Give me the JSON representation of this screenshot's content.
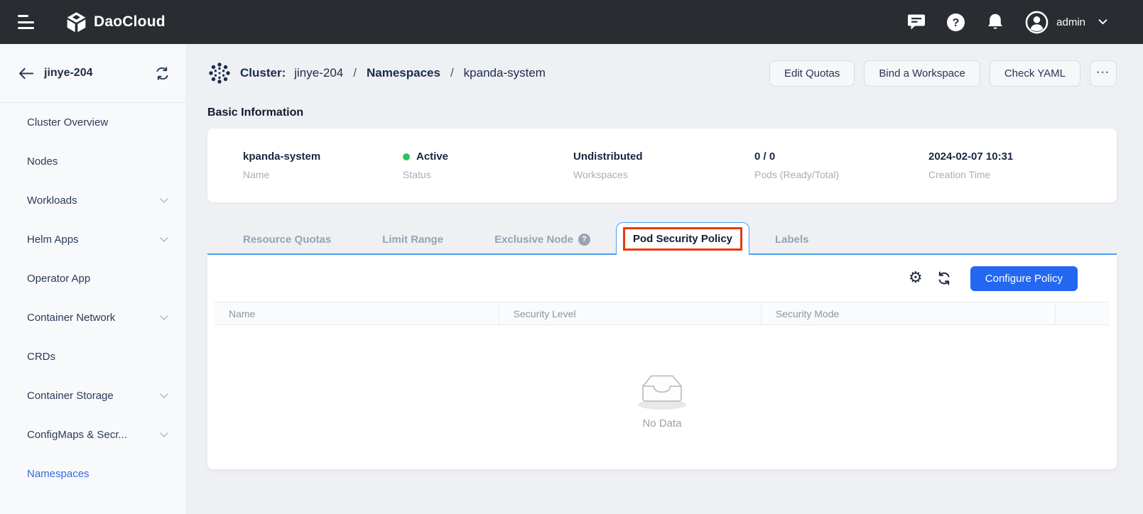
{
  "topbar": {
    "brand": "DaoCloud",
    "user": "admin"
  },
  "sidebar": {
    "cluster_name": "jinye-204",
    "items": [
      {
        "label": "Cluster Overview",
        "expandable": false,
        "active": false
      },
      {
        "label": "Nodes",
        "expandable": false,
        "active": false
      },
      {
        "label": "Workloads",
        "expandable": true,
        "active": false
      },
      {
        "label": "Helm Apps",
        "expandable": true,
        "active": false
      },
      {
        "label": "Operator App",
        "expandable": false,
        "active": false
      },
      {
        "label": "Container Network",
        "expandable": true,
        "active": false
      },
      {
        "label": "CRDs",
        "expandable": false,
        "active": false
      },
      {
        "label": "Container Storage",
        "expandable": true,
        "active": false
      },
      {
        "label": "ConfigMaps & Secr...",
        "expandable": true,
        "active": false
      },
      {
        "label": "Namespaces",
        "expandable": false,
        "active": true
      }
    ]
  },
  "breadcrumb": {
    "label": "Cluster:",
    "cluster": "jinye-204",
    "sep1": "/",
    "section": "Namespaces",
    "sep2": "/",
    "current": "kpanda-system"
  },
  "actions": {
    "edit_quotas": "Edit Quotas",
    "bind_workspace": "Bind a Workspace",
    "check_yaml": "Check YAML",
    "more": "···"
  },
  "basic_info": {
    "title": "Basic Information",
    "fields": [
      {
        "value": "kpanda-system",
        "label": "Name"
      },
      {
        "value": "Active",
        "label": "Status"
      },
      {
        "value": "Undistributed",
        "label": "Workspaces"
      },
      {
        "value": "0 / 0",
        "label": "Pods (Ready/Total)"
      },
      {
        "value": "2024-02-07 10:31",
        "label": "Creation Time"
      }
    ]
  },
  "tabs": [
    {
      "label": "Resource Quotas",
      "active": false
    },
    {
      "label": "Limit Range",
      "active": false
    },
    {
      "label": "Exclusive Node",
      "active": false,
      "help": true
    },
    {
      "label": "Pod Security Policy",
      "active": true,
      "highlighted": true
    },
    {
      "label": "Labels",
      "active": false
    }
  ],
  "policy_panel": {
    "configure_button": "Configure Policy",
    "columns": [
      "Name",
      "Security Level",
      "Security Mode"
    ],
    "rows": [],
    "empty_text": "No Data"
  },
  "colors": {
    "topbar_bg": "#292c31",
    "primary_blue": "#2468f2",
    "tab_border_blue": "#4aa0f5",
    "link_blue": "#3568e0",
    "status_green": "#2fc25b",
    "highlight_red": "#e8380d"
  }
}
